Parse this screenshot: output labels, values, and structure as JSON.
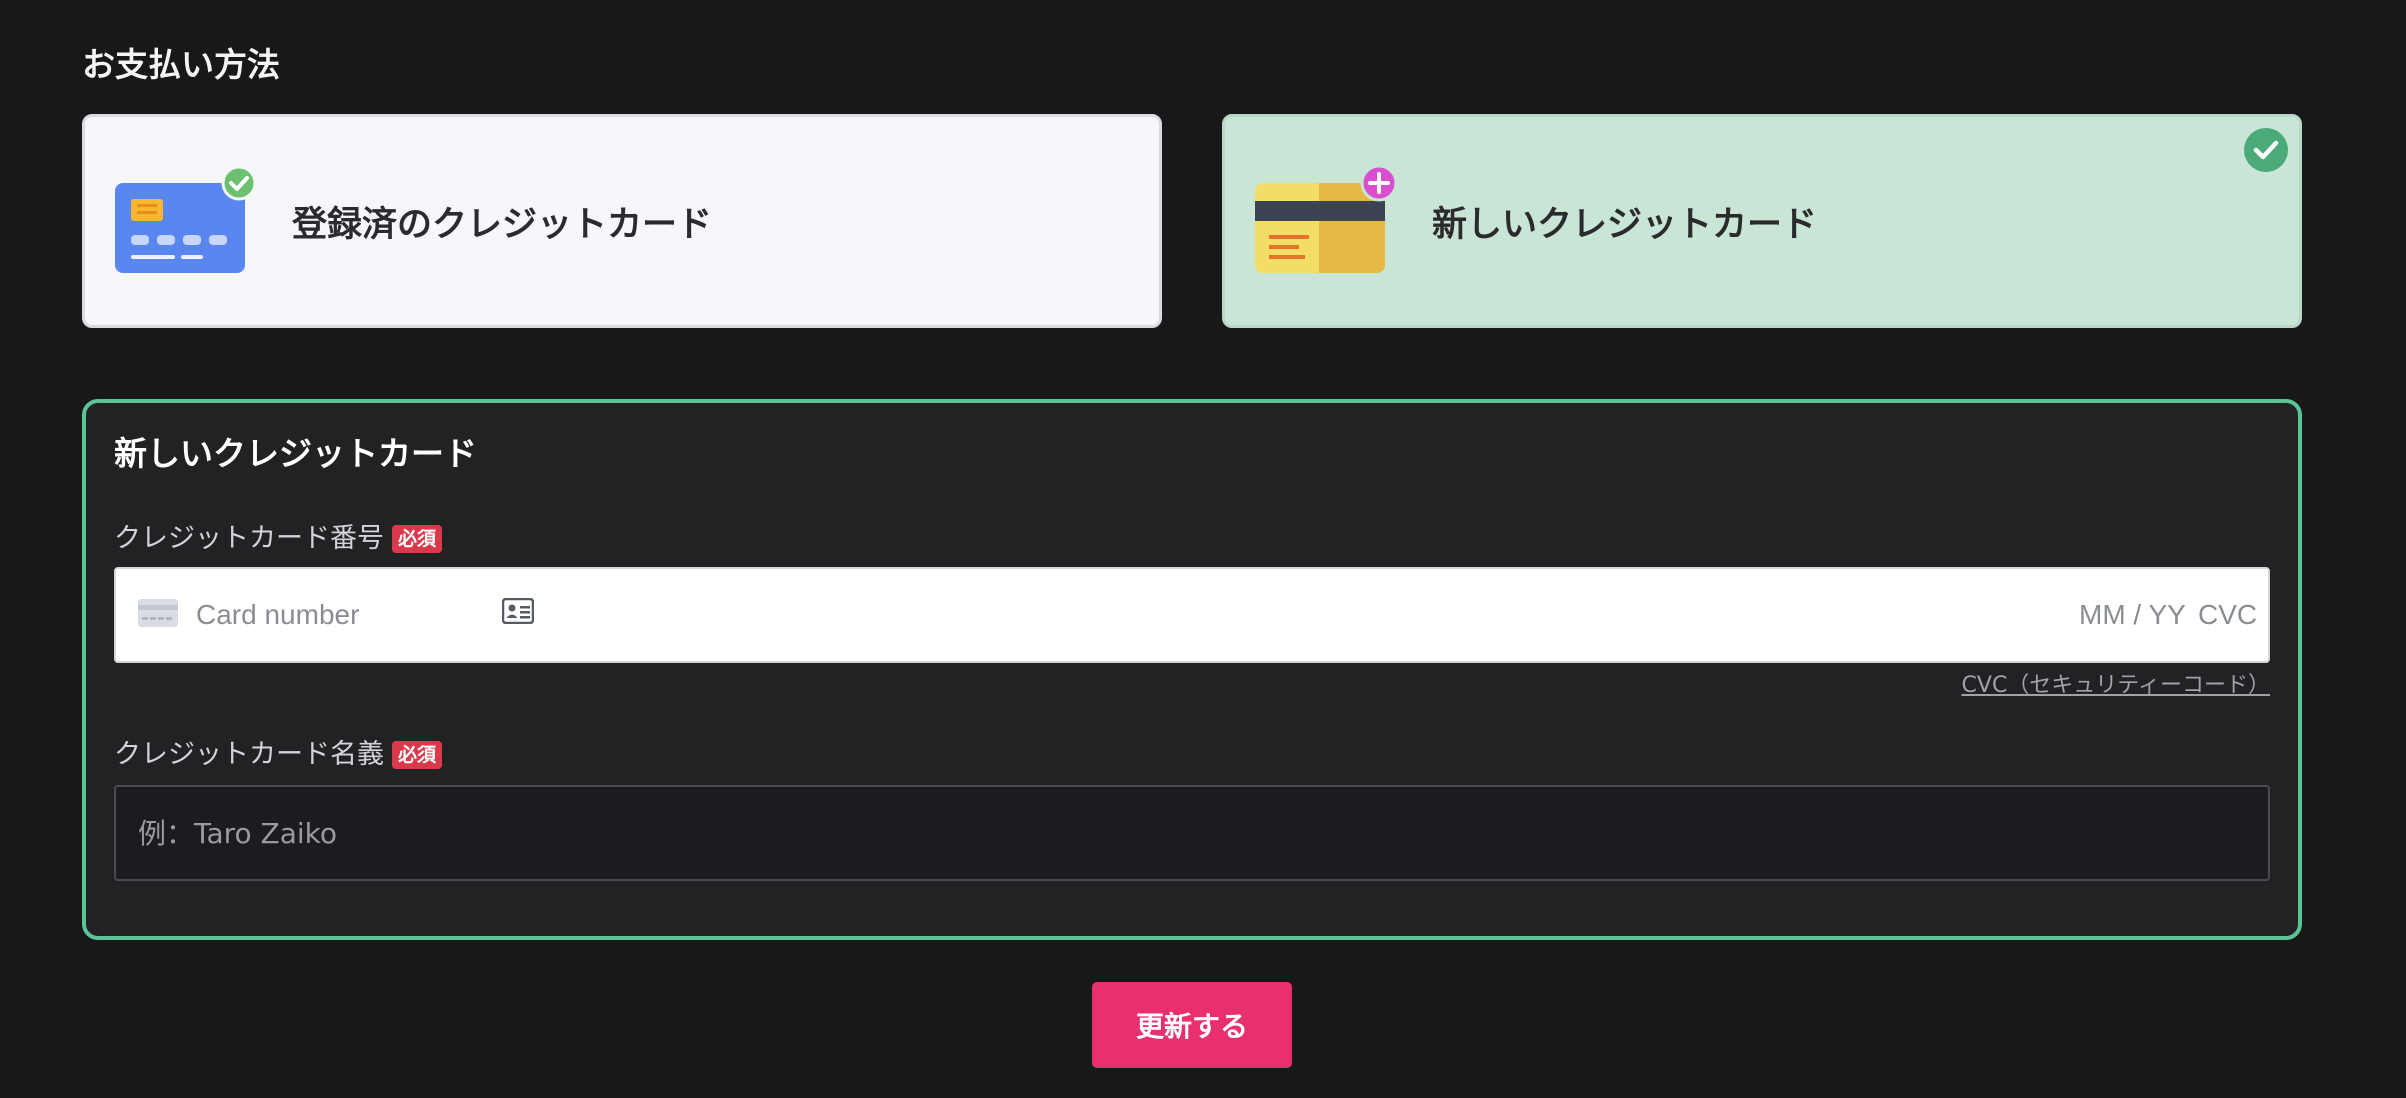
{
  "section": {
    "title": "お支払い方法"
  },
  "payment_methods": [
    {
      "label": "登録済のクレジットカード",
      "selected": false
    },
    {
      "label": "新しいクレジットカード",
      "selected": true
    }
  ],
  "form": {
    "title": "新しいクレジットカード",
    "card_number": {
      "label": "クレジットカード番号",
      "required_badge": "必須",
      "placeholder": "Card number",
      "expiry_placeholder": "MM / YY",
      "cvc_placeholder": "CVC"
    },
    "cvc_help_link": "CVC（セキュリティーコード）",
    "card_holder": {
      "label": "クレジットカード名義",
      "required_badge": "必須",
      "placeholder": "例：Taro Zaiko"
    },
    "submit_label": "更新する"
  },
  "colors": {
    "accent": "#e8306f",
    "selected_border": "#5cc397",
    "selected_bg": "#c9e5d6",
    "required": "#d9394a"
  }
}
